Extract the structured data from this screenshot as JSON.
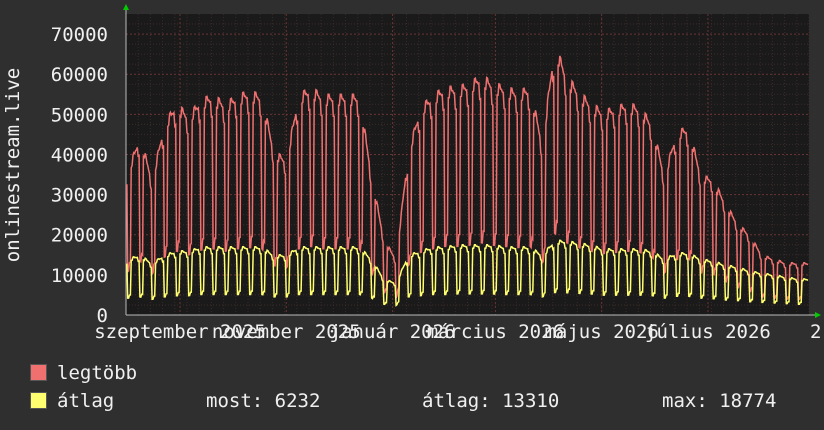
{
  "chart_data": {
    "type": "line",
    "ylabel": "onlinestream.live",
    "ylim": [
      0,
      75000
    ],
    "yticks": [
      0,
      10000,
      20000,
      30000,
      40000,
      50000,
      60000,
      70000
    ],
    "ytick_labels": [
      "0",
      "10000",
      "20000",
      "30000",
      "40000",
      "50000",
      "60000",
      "70000"
    ],
    "xtick_labels": [
      "szeptember 2025",
      "november 2025",
      "január 2026",
      "március 2026",
      "május 2026",
      "július 2026",
      "2"
    ],
    "x_start": "2025-08-01",
    "x_end": "2026-08-28",
    "grid": true,
    "series": [
      {
        "name": "legtöbb",
        "color": "#f07070",
        "daily_profile": "weekday plateau, weekend drop",
        "weekly_points": [
          [
            "2025-08-02",
            36000
          ],
          [
            "2025-08-09",
            45000
          ],
          [
            "2025-08-16",
            34000
          ],
          [
            "2025-08-23",
            48000
          ],
          [
            "2025-08-30",
            53000
          ],
          [
            "2025-09-06",
            50000
          ],
          [
            "2025-09-13",
            54000
          ],
          [
            "2025-09-20",
            55000
          ],
          [
            "2025-09-27",
            53000
          ],
          [
            "2025-10-04",
            55000
          ],
          [
            "2025-10-11",
            56000
          ],
          [
            "2025-10-18",
            55000
          ],
          [
            "2025-10-25",
            41000
          ],
          [
            "2025-11-01",
            39000
          ],
          [
            "2025-11-08",
            55000
          ],
          [
            "2025-11-15",
            57000
          ],
          [
            "2025-11-22",
            55000
          ],
          [
            "2025-11-29",
            55000
          ],
          [
            "2025-12-06",
            55000
          ],
          [
            "2025-12-13",
            55000
          ],
          [
            "2025-12-20",
            35000
          ],
          [
            "2025-12-27",
            19000
          ],
          [
            "2026-01-03",
            14000
          ],
          [
            "2026-01-10",
            41000
          ],
          [
            "2026-01-17",
            52000
          ],
          [
            "2026-01-24",
            55000
          ],
          [
            "2026-01-31",
            57000
          ],
          [
            "2026-02-07",
            57000
          ],
          [
            "2026-02-14",
            58000
          ],
          [
            "2026-02-21",
            60000
          ],
          [
            "2026-02-28",
            58000
          ],
          [
            "2026-03-07",
            57000
          ],
          [
            "2026-03-14",
            56000
          ],
          [
            "2026-03-21",
            57000
          ],
          [
            "2026-03-28",
            43000
          ],
          [
            "2026-04-04",
            68000
          ],
          [
            "2026-04-11",
            60000
          ],
          [
            "2026-04-18",
            56000
          ],
          [
            "2026-04-25",
            53000
          ],
          [
            "2026-05-02",
            51000
          ],
          [
            "2026-05-09",
            52000
          ],
          [
            "2026-05-16",
            53000
          ],
          [
            "2026-05-23",
            52000
          ],
          [
            "2026-05-30",
            48000
          ],
          [
            "2026-06-06",
            35000
          ],
          [
            "2026-06-13",
            46000
          ],
          [
            "2026-06-20",
            47000
          ],
          [
            "2026-06-27",
            35000
          ],
          [
            "2026-07-04",
            34000
          ],
          [
            "2026-07-11",
            28000
          ],
          [
            "2026-07-18",
            23000
          ],
          [
            "2026-07-25",
            20000
          ],
          [
            "2026-08-01",
            15000
          ],
          [
            "2026-08-08",
            14000
          ],
          [
            "2026-08-15",
            13000
          ],
          [
            "2026-08-22",
            13000
          ]
        ]
      },
      {
        "name": "átlag",
        "color": "#ffff70",
        "daily_profile": "weekday plateau, weekend drop",
        "weekly_points": [
          [
            "2025-08-02",
            14000
          ],
          [
            "2025-08-09",
            15000
          ],
          [
            "2025-08-16",
            13000
          ],
          [
            "2025-08-23",
            15000
          ],
          [
            "2025-08-30",
            16000
          ],
          [
            "2025-09-06",
            16000
          ],
          [
            "2025-09-13",
            17000
          ],
          [
            "2025-09-20",
            17000
          ],
          [
            "2025-09-27",
            17000
          ],
          [
            "2025-10-04",
            17000
          ],
          [
            "2025-10-11",
            17000
          ],
          [
            "2025-10-18",
            17000
          ],
          [
            "2025-10-25",
            15000
          ],
          [
            "2025-11-01",
            15000
          ],
          [
            "2025-11-08",
            17000
          ],
          [
            "2025-11-15",
            17000
          ],
          [
            "2025-11-22",
            17000
          ],
          [
            "2025-11-29",
            17000
          ],
          [
            "2025-12-06",
            17000
          ],
          [
            "2025-12-13",
            17000
          ],
          [
            "2025-12-20",
            14000
          ],
          [
            "2025-12-27",
            9000
          ],
          [
            "2026-01-03",
            8000
          ],
          [
            "2026-01-10",
            15000
          ],
          [
            "2026-01-17",
            16000
          ],
          [
            "2026-01-24",
            17000
          ],
          [
            "2026-01-31",
            17000
          ],
          [
            "2026-02-07",
            17500
          ],
          [
            "2026-02-14",
            17500
          ],
          [
            "2026-02-21",
            17500
          ],
          [
            "2026-02-28",
            17500
          ],
          [
            "2026-03-07",
            17000
          ],
          [
            "2026-03-14",
            17000
          ],
          [
            "2026-03-21",
            17000
          ],
          [
            "2026-03-28",
            15000
          ],
          [
            "2026-04-04",
            18700
          ],
          [
            "2026-04-11",
            18500
          ],
          [
            "2026-04-18",
            18000
          ],
          [
            "2026-04-25",
            17500
          ],
          [
            "2026-05-02",
            16500
          ],
          [
            "2026-05-09",
            16500
          ],
          [
            "2026-05-16",
            16500
          ],
          [
            "2026-05-23",
            16500
          ],
          [
            "2026-05-30",
            16000
          ],
          [
            "2026-06-06",
            14000
          ],
          [
            "2026-06-13",
            15500
          ],
          [
            "2026-06-20",
            15500
          ],
          [
            "2026-06-27",
            14000
          ],
          [
            "2026-07-04",
            13500
          ],
          [
            "2026-07-11",
            12500
          ],
          [
            "2026-07-18",
            12000
          ],
          [
            "2026-07-25",
            11000
          ],
          [
            "2026-08-01",
            10500
          ],
          [
            "2026-08-08",
            10000
          ],
          [
            "2026-08-15",
            9500
          ],
          [
            "2026-08-22",
            9000
          ]
        ]
      }
    ]
  },
  "legend": {
    "max_label": "legtöbb",
    "avg_label": "átlag",
    "current": "most: 6232",
    "average": "átlag: 13310",
    "maximum": "max: 18774"
  },
  "colors": {
    "background": "#2f2f2f",
    "plot_bg": "#1a1a1a",
    "grid_minor": "#3a2a2a",
    "grid_major": "#5a3030",
    "axis_arrow": "#00cc00"
  }
}
